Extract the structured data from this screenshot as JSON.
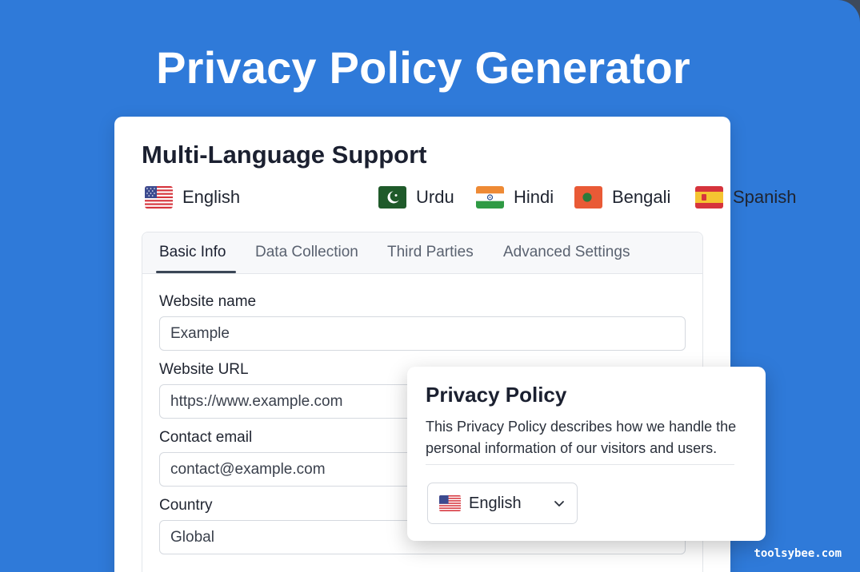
{
  "hero": {
    "title": "Privacy Policy Generator"
  },
  "card": {
    "title": "Multi-Language Support"
  },
  "languages": [
    {
      "name": "English",
      "icon": "us-flag-icon"
    },
    {
      "name": "Urdu",
      "icon": "pakistan-flag-icon"
    },
    {
      "name": "Hindi",
      "icon": "india-flag-icon"
    },
    {
      "name": "Bengali",
      "icon": "bangladesh-flag-icon"
    },
    {
      "name": "Spanish",
      "icon": "spain-flag-icon"
    }
  ],
  "tabs": [
    {
      "label": "Basic Info",
      "active": true
    },
    {
      "label": "Data Collection",
      "active": false
    },
    {
      "label": "Third Parties",
      "active": false
    },
    {
      "label": "Advanced Settings",
      "active": false
    }
  ],
  "form": {
    "website_name": {
      "label": "Website name",
      "value": "Example"
    },
    "website_url": {
      "label": "Website URL",
      "value": "https://www.example.com"
    },
    "contact_email": {
      "label": "Contact email",
      "value": "contact@example.com"
    },
    "country": {
      "label": "Country",
      "value": "Global"
    }
  },
  "popup": {
    "title": "Privacy Policy",
    "body": "This Privacy Policy describes how we handle the personal information of our visitors and users.",
    "language_select": {
      "selected": "English",
      "icon": "us-flag-icon"
    }
  },
  "watermark": "toolsybee.com",
  "colors": {
    "background": "#2f7ad9",
    "card": "#ffffff",
    "text": "#1f2430",
    "tab_underline": "#3b4656"
  }
}
